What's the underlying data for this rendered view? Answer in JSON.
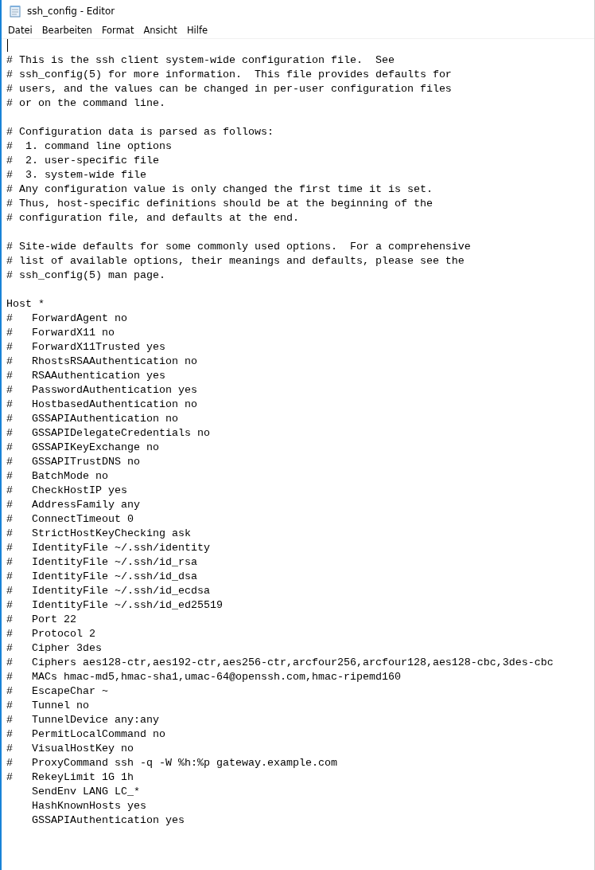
{
  "window": {
    "title": "ssh_config - Editor"
  },
  "menu": [
    "Datei",
    "Bearbeiten",
    "Format",
    "Ansicht",
    "Hilfe"
  ],
  "lines": [
    {
      "kind": "blank",
      "caret": true
    },
    {
      "kind": "text",
      "text": "# This is the ssh client system-wide configuration file.  See"
    },
    {
      "kind": "text",
      "text": "# ssh_config(5) for more information.  This file provides defaults for"
    },
    {
      "kind": "text",
      "text": "# users, and the values can be changed in per-user configuration files"
    },
    {
      "kind": "text",
      "text": "# or on the command line."
    },
    {
      "kind": "blank"
    },
    {
      "kind": "text",
      "text": "# Configuration data is parsed as follows:"
    },
    {
      "kind": "text",
      "text": "#  1. command line options"
    },
    {
      "kind": "text",
      "text": "#  2. user-specific file"
    },
    {
      "kind": "text",
      "text": "#  3. system-wide file"
    },
    {
      "kind": "text",
      "text": "# Any configuration value is only changed the first time it is set."
    },
    {
      "kind": "text",
      "text": "# Thus, host-specific definitions should be at the beginning of the"
    },
    {
      "kind": "text",
      "text": "# configuration file, and defaults at the end."
    },
    {
      "kind": "blank"
    },
    {
      "kind": "text",
      "text": "# Site-wide defaults for some commonly used options.  For a comprehensive"
    },
    {
      "kind": "text",
      "text": "# list of available options, their meanings and defaults, please see the"
    },
    {
      "kind": "text",
      "text": "# ssh_config(5) man page."
    },
    {
      "kind": "blank"
    },
    {
      "kind": "text",
      "text": "Host *"
    },
    {
      "kind": "text",
      "text": "#   ForwardAgent no"
    },
    {
      "kind": "text",
      "text": "#   ForwardX11 no"
    },
    {
      "kind": "text",
      "text": "#   ForwardX11Trusted yes"
    },
    {
      "kind": "text",
      "text": "#   RhostsRSAAuthentication no"
    },
    {
      "kind": "text",
      "text": "#   RSAAuthentication yes"
    },
    {
      "kind": "text",
      "text": "#   PasswordAuthentication yes"
    },
    {
      "kind": "text",
      "text": "#   HostbasedAuthentication no"
    },
    {
      "kind": "text",
      "text": "#   GSSAPIAuthentication no"
    },
    {
      "kind": "text",
      "text": "#   GSSAPIDelegateCredentials no"
    },
    {
      "kind": "text",
      "text": "#   GSSAPIKeyExchange no"
    },
    {
      "kind": "text",
      "text": "#   GSSAPITrustDNS no"
    },
    {
      "kind": "text",
      "text": "#   BatchMode no"
    },
    {
      "kind": "text",
      "text": "#   CheckHostIP yes"
    },
    {
      "kind": "text",
      "text": "#   AddressFamily any"
    },
    {
      "kind": "text",
      "text": "#   ConnectTimeout 0"
    },
    {
      "kind": "text",
      "text": "#   StrictHostKeyChecking ask"
    },
    {
      "kind": "text",
      "text": "#   IdentityFile ~/.ssh/identity"
    },
    {
      "kind": "text",
      "text": "#   IdentityFile ~/.ssh/id_rsa"
    },
    {
      "kind": "text",
      "text": "#   IdentityFile ~/.ssh/id_dsa"
    },
    {
      "kind": "text",
      "text": "#   IdentityFile ~/.ssh/id_ecdsa"
    },
    {
      "kind": "text",
      "text": "#   IdentityFile ~/.ssh/id_ed25519"
    },
    {
      "kind": "text",
      "text": "#   Port 22"
    },
    {
      "kind": "text",
      "text": "#   Protocol 2"
    },
    {
      "kind": "text",
      "text": "#   Cipher 3des"
    },
    {
      "kind": "text",
      "text": "#   Ciphers aes128-ctr,aes192-ctr,aes256-ctr,arcfour256,arcfour128,aes128-cbc,3des-cbc"
    },
    {
      "kind": "text",
      "text": "#   MACs hmac-md5,hmac-sha1,umac-64@openssh.com,hmac-ripemd160"
    },
    {
      "kind": "text",
      "text": "#   EscapeChar ~"
    },
    {
      "kind": "text",
      "text": "#   Tunnel no"
    },
    {
      "kind": "text",
      "text": "#   TunnelDevice any:any"
    },
    {
      "kind": "text",
      "text": "#   PermitLocalCommand no"
    },
    {
      "kind": "text",
      "text": "#   VisualHostKey no"
    },
    {
      "kind": "text",
      "text": "#   ProxyCommand ssh -q -W %h:%p gateway.example.com"
    },
    {
      "kind": "text",
      "text": "#   RekeyLimit 1G 1h"
    },
    {
      "kind": "text",
      "text": "    SendEnv LANG LC_*"
    },
    {
      "kind": "text",
      "text": "    HashKnownHosts yes"
    },
    {
      "kind": "text",
      "text": "    GSSAPIAuthentication yes"
    }
  ]
}
